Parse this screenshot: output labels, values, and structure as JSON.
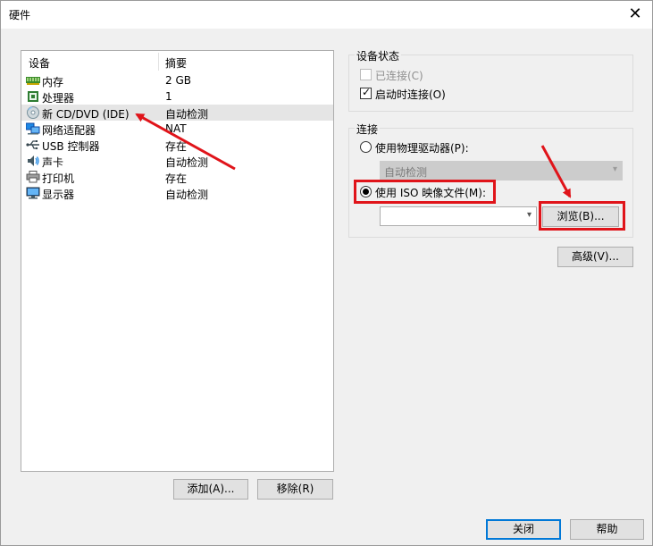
{
  "window": {
    "title": "硬件"
  },
  "device_list": {
    "headers": {
      "device": "设备",
      "summary": "摘要"
    },
    "rows": [
      {
        "icon": "memory-icon",
        "name": "内存",
        "summary": "2 GB"
      },
      {
        "icon": "processor-icon",
        "name": "处理器",
        "summary": "1"
      },
      {
        "icon": "cd-dvd-icon",
        "name": "新 CD/DVD (IDE)",
        "summary": "自动检测"
      },
      {
        "icon": "network-adapter-icon",
        "name": "网络适配器",
        "summary": "NAT"
      },
      {
        "icon": "usb-icon",
        "name": "USB 控制器",
        "summary": "存在"
      },
      {
        "icon": "sound-card-icon",
        "name": "声卡",
        "summary": "自动检测"
      },
      {
        "icon": "printer-icon",
        "name": "打印机",
        "summary": "存在"
      },
      {
        "icon": "display-icon",
        "name": "显示器",
        "summary": "自动检测"
      }
    ],
    "selected": "新 CD/DVD (IDE)"
  },
  "buttons": {
    "add": "添加(A)...",
    "remove": "移除(R)",
    "browse": "浏览(B)...",
    "advanced": "高级(V)...",
    "close": "关闭",
    "help": "帮助"
  },
  "device_status": {
    "title": "设备状态",
    "connected": {
      "label": "已连接(C)",
      "checked": false,
      "enabled": false
    },
    "connect_on_power_on": {
      "label": "启动时连接(O)",
      "checked": true
    }
  },
  "connection": {
    "title": "连接",
    "physical_drive": {
      "label": "使用物理驱动器(P):",
      "selected": false
    },
    "physical_drive_value": "自动检测",
    "iso_image": {
      "label": "使用 ISO 映像文件(M):",
      "selected": true
    },
    "iso_path": ""
  },
  "annotation_color": "#e0141a"
}
